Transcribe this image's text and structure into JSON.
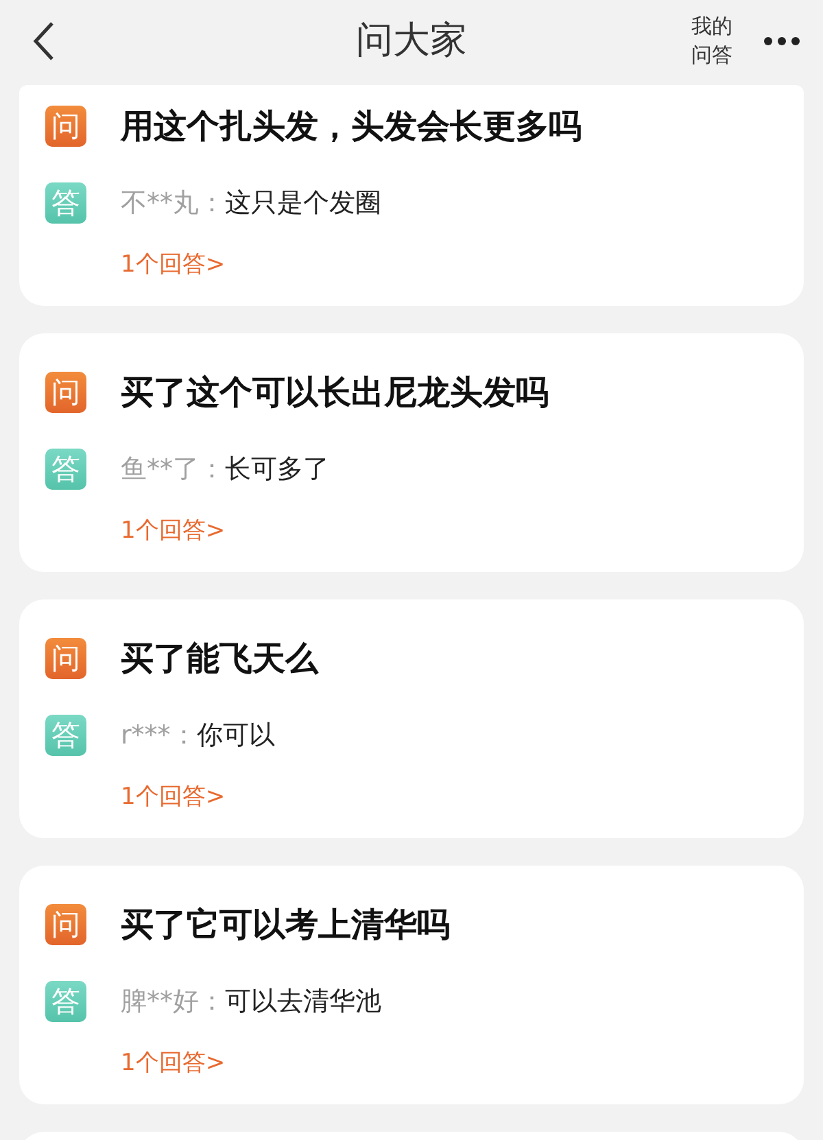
{
  "header": {
    "title": "问大家",
    "my_qa": [
      "我的",
      "问答"
    ]
  },
  "questions": [
    {
      "q_badge": "问",
      "question": "用这个扎头发，头发会长更多吗",
      "a_badge": "答",
      "user": "不**丸：",
      "answer": "这只是个发圈",
      "link": "1个回答>"
    },
    {
      "q_badge": "问",
      "question": "买了这个可以长出尼龙头发吗",
      "a_badge": "答",
      "user": "鱼**了：",
      "answer": "长可多了",
      "link": "1个回答>"
    },
    {
      "q_badge": "问",
      "question": "买了能飞天么",
      "a_badge": "答",
      "user": "r***：",
      "answer": "你可以",
      "link": "1个回答>"
    },
    {
      "q_badge": "问",
      "question": "买了它可以考上清华吗",
      "a_badge": "答",
      "user": "脾**好：",
      "answer": "可以去清华池",
      "link": "1个回答>"
    }
  ]
}
